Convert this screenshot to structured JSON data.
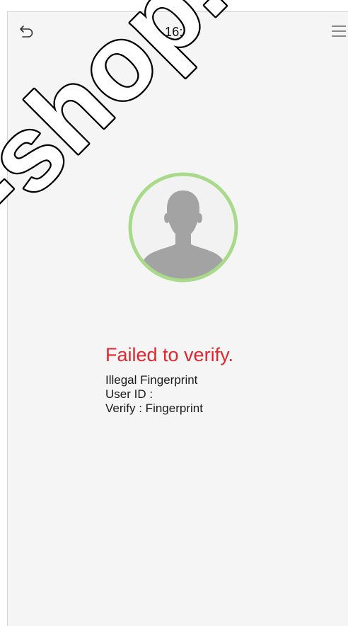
{
  "status_bar": {
    "time": "16:13",
    "back_icon": "undo-arrow-icon",
    "menu_icon": "hamburger-menu-icon"
  },
  "avatar": {
    "icon": "person-silhouette-icon",
    "ring_color": "#a9d98b",
    "fill_color": "#f2f2f2",
    "silhouette_color": "#a3a3a3"
  },
  "result": {
    "title": "Failed to verify.",
    "title_color": "#e0262e",
    "message": "Illegal Fingerprint",
    "user_id": "User ID :",
    "verify_mode": "Verify : Fingerprint"
  },
  "watermark": {
    "text": "-shop."
  }
}
